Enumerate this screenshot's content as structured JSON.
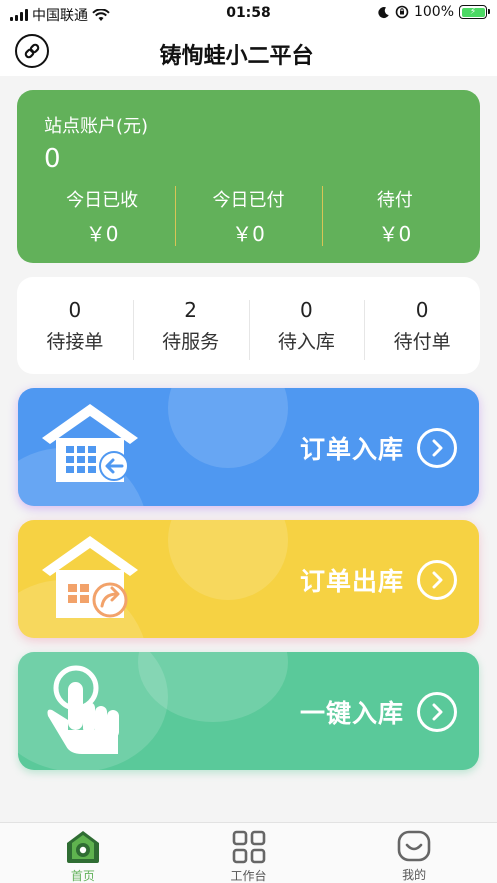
{
  "status_bar": {
    "carrier": "中国联通",
    "time": "01:58",
    "battery": "100%"
  },
  "header": {
    "title": "铸恂蛙小二平台",
    "link_icon": "link-icon"
  },
  "account": {
    "label": "站点账户(元)",
    "value": "0",
    "stats": [
      {
        "label": "今日已收",
        "value": "￥0"
      },
      {
        "label": "今日已付",
        "value": "￥0"
      },
      {
        "label": "待付",
        "value": "￥0"
      }
    ],
    "color": "#62b15a"
  },
  "orders": [
    {
      "count": "0",
      "label": "待接单"
    },
    {
      "count": "2",
      "label": "待服务"
    },
    {
      "count": "0",
      "label": "待入库"
    },
    {
      "count": "0",
      "label": "待付单"
    }
  ],
  "actions": [
    {
      "label": "订单入库",
      "icon": "warehouse-in-icon",
      "color": "#4f98f1"
    },
    {
      "label": "订单出库",
      "icon": "warehouse-out-icon",
      "color": "#f6d243"
    },
    {
      "label": "一键入库",
      "icon": "tap-hand-icon",
      "color": "#5ac99a"
    }
  ],
  "tab_bar": [
    {
      "label": "首页",
      "icon": "home-icon",
      "active": true
    },
    {
      "label": "工作台",
      "icon": "grid-icon",
      "active": false
    },
    {
      "label": "我的",
      "icon": "profile-icon",
      "active": false
    }
  ]
}
